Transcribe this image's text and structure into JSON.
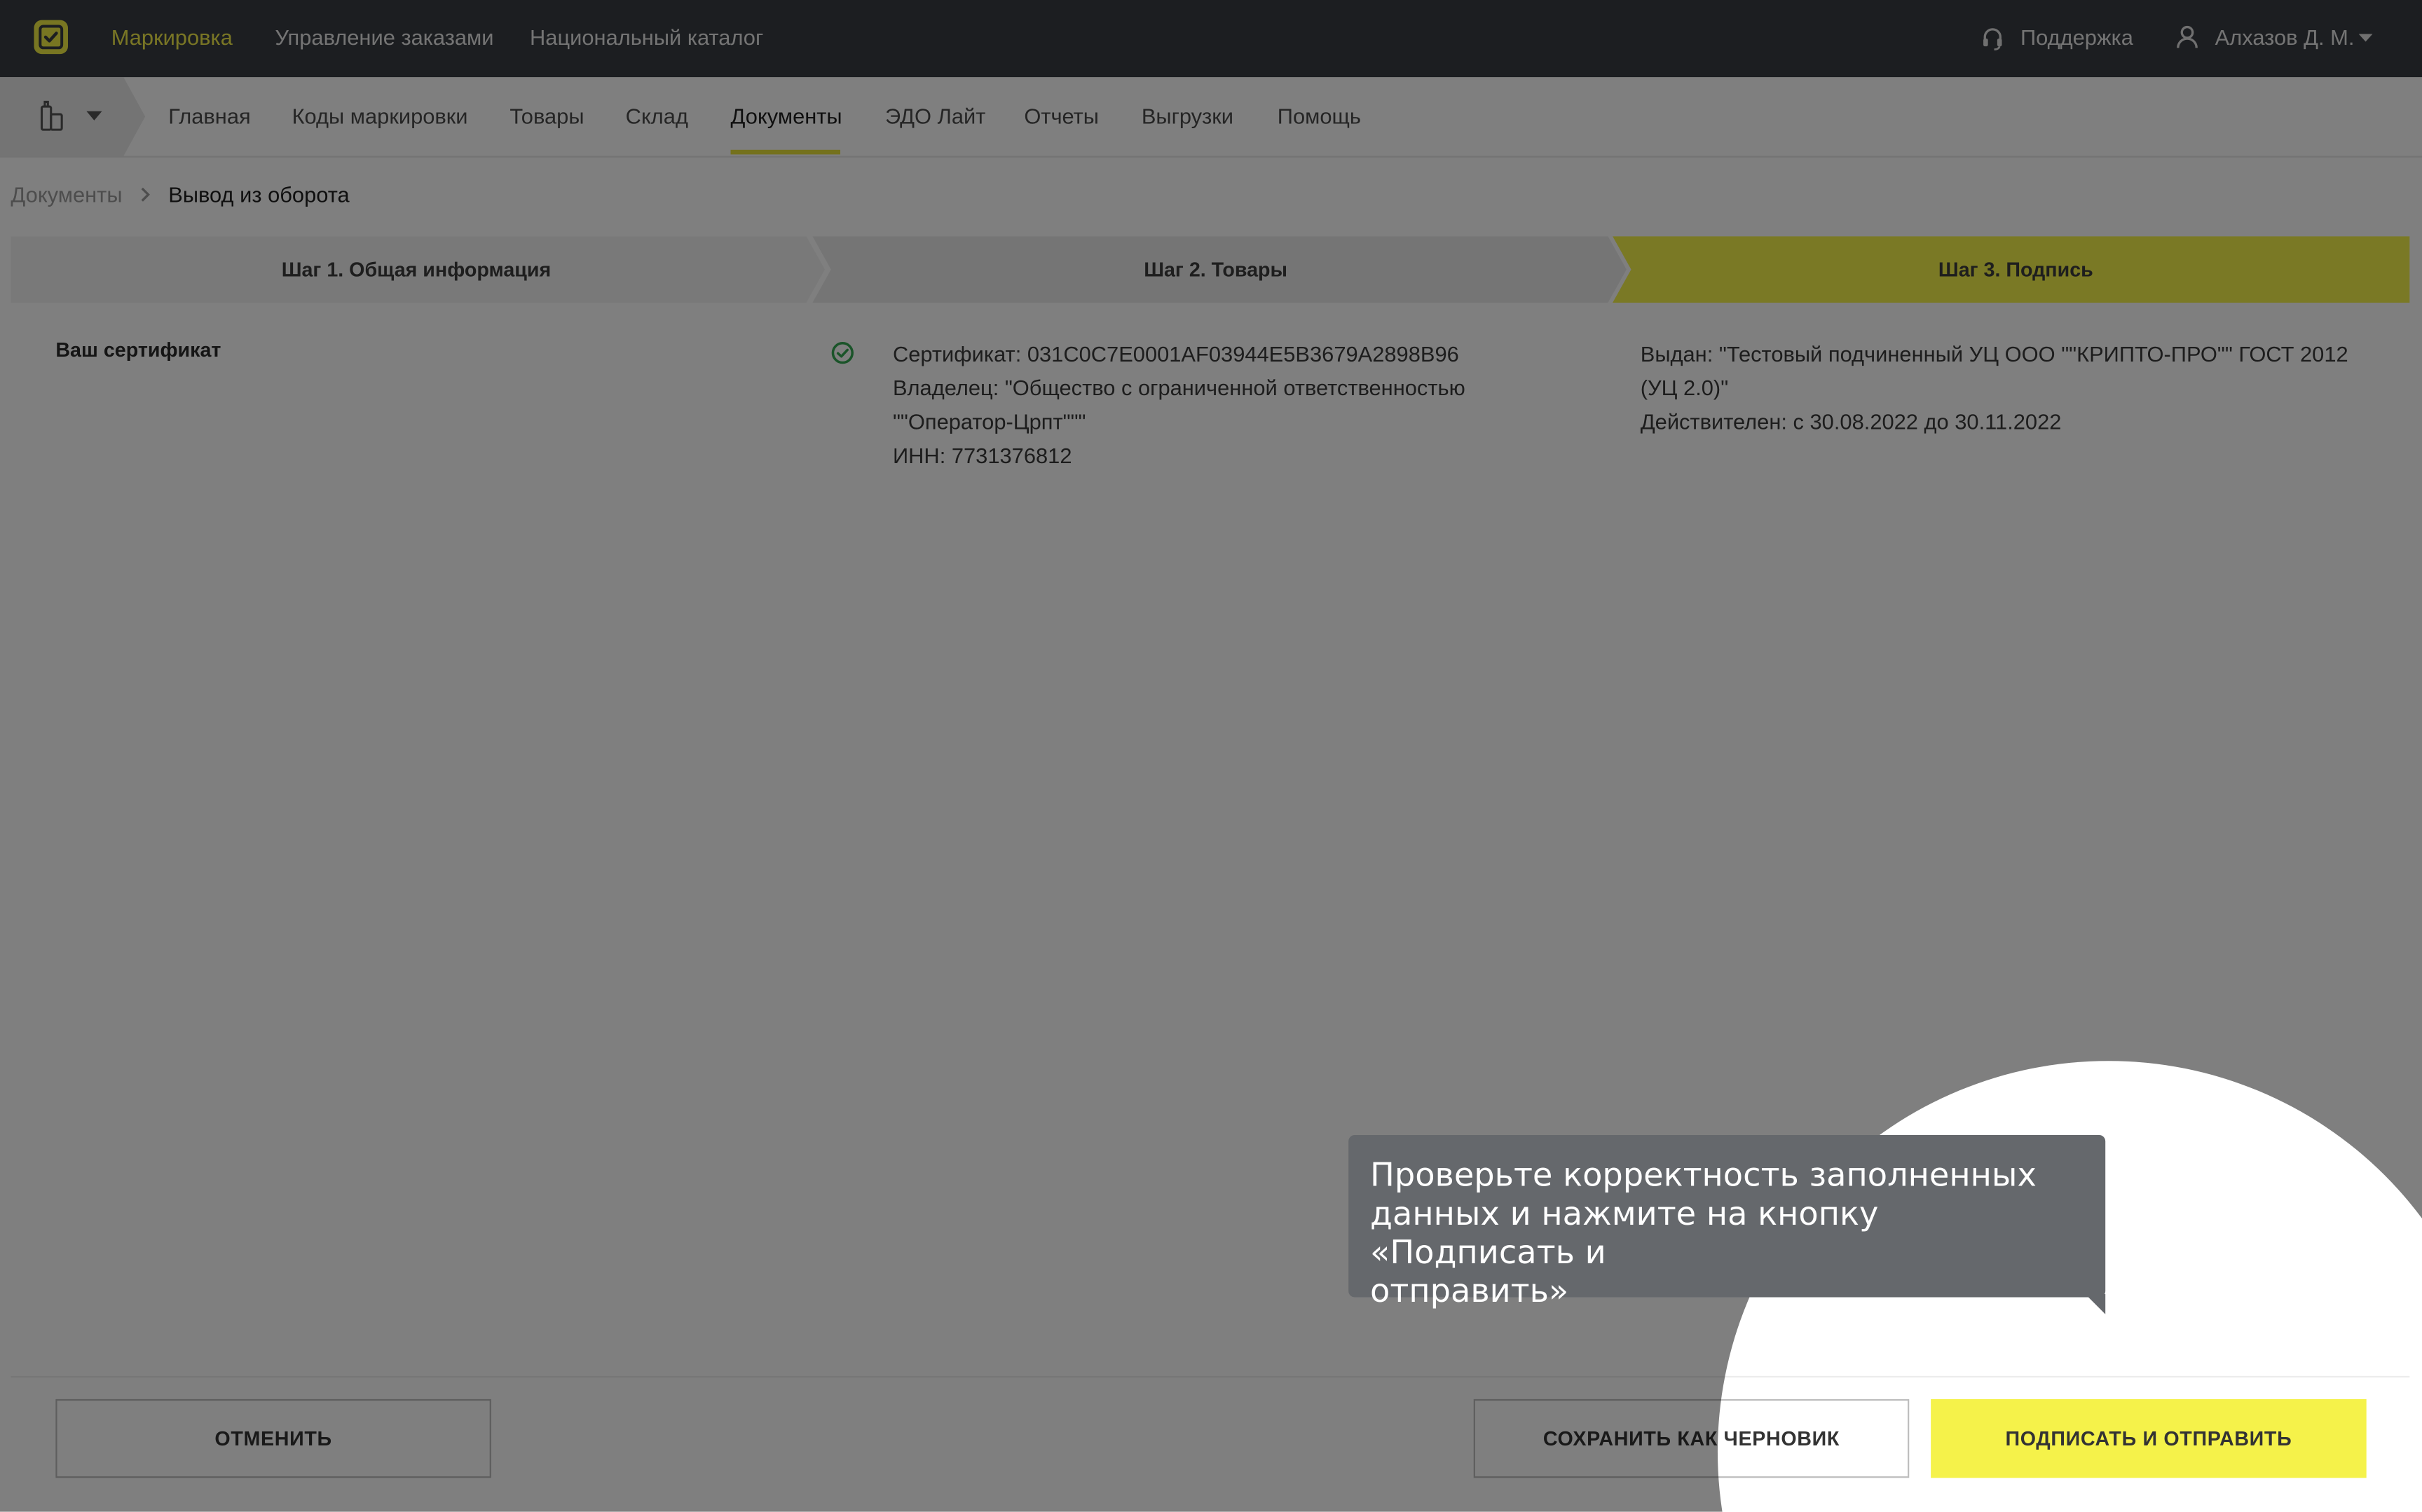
{
  "app": {
    "top_nav": [
      {
        "label": "Маркировка",
        "active": true
      },
      {
        "label": "Управление заказами",
        "active": false
      },
      {
        "label": "Национальный каталог",
        "active": false
      }
    ],
    "support_label": "Поддержка",
    "user_name": "Алхазов Д. М."
  },
  "sub_nav": {
    "items": [
      {
        "label": "Главная",
        "active": false
      },
      {
        "label": "Коды маркировки",
        "active": false
      },
      {
        "label": "Товары",
        "active": false
      },
      {
        "label": "Склад",
        "active": false
      },
      {
        "label": "Документы",
        "active": true
      },
      {
        "label": "ЭДО Лайт",
        "active": false
      },
      {
        "label": "Отчеты",
        "active": false
      },
      {
        "label": "Выгрузки",
        "active": false
      },
      {
        "label": "Помощь",
        "active": false
      }
    ]
  },
  "breadcrumb": {
    "parent": "Документы",
    "current": "Вывод из оборота"
  },
  "steps": [
    {
      "label": "Шаг 1. Общая информация",
      "active": false
    },
    {
      "label": "Шаг 2. Товары",
      "active": false
    },
    {
      "label": "Шаг 3. Подпись",
      "active": true
    }
  ],
  "certificate": {
    "section_label": "Ваш сертификат",
    "cert_line": "Сертификат: 031C0C7E0001AF03944E5B3679A2898B96",
    "owner_line1": "Владелец: \"Общество с ограниченной ответственностью",
    "owner_line2": "\"\"Оператор-Црпт\"\"\"",
    "inn_line": "ИНН: 7731376812",
    "issuer_line1": "Выдан: \"Тестовый подчиненный УЦ ООО \"\"КРИПТО-ПРО\"\" ГОСТ 2012",
    "issuer_line2": "(УЦ 2.0)\"",
    "validity_line": "Действителен: с 30.08.2022 до 30.11.2022"
  },
  "buttons": {
    "cancel": "ОТМЕНИТЬ",
    "save_draft": "СОХРАНИТЬ КАК ЧЕРНОВИК",
    "sign_send": "ПОДПИСАТЬ И ОТПРАВИТЬ"
  },
  "tooltip": {
    "line1": "Проверьте корректность заполненных",
    "line2": "данных и нажмите на кнопку «Подписать и",
    "line3": "отправить»"
  },
  "colors": {
    "accent_yellow": "#f5f24a",
    "topbar": "#383c42",
    "overlay": "rgba(0,0,0,0.5)",
    "tooltip_bg": "#65686c",
    "check_green": "#35a853"
  }
}
